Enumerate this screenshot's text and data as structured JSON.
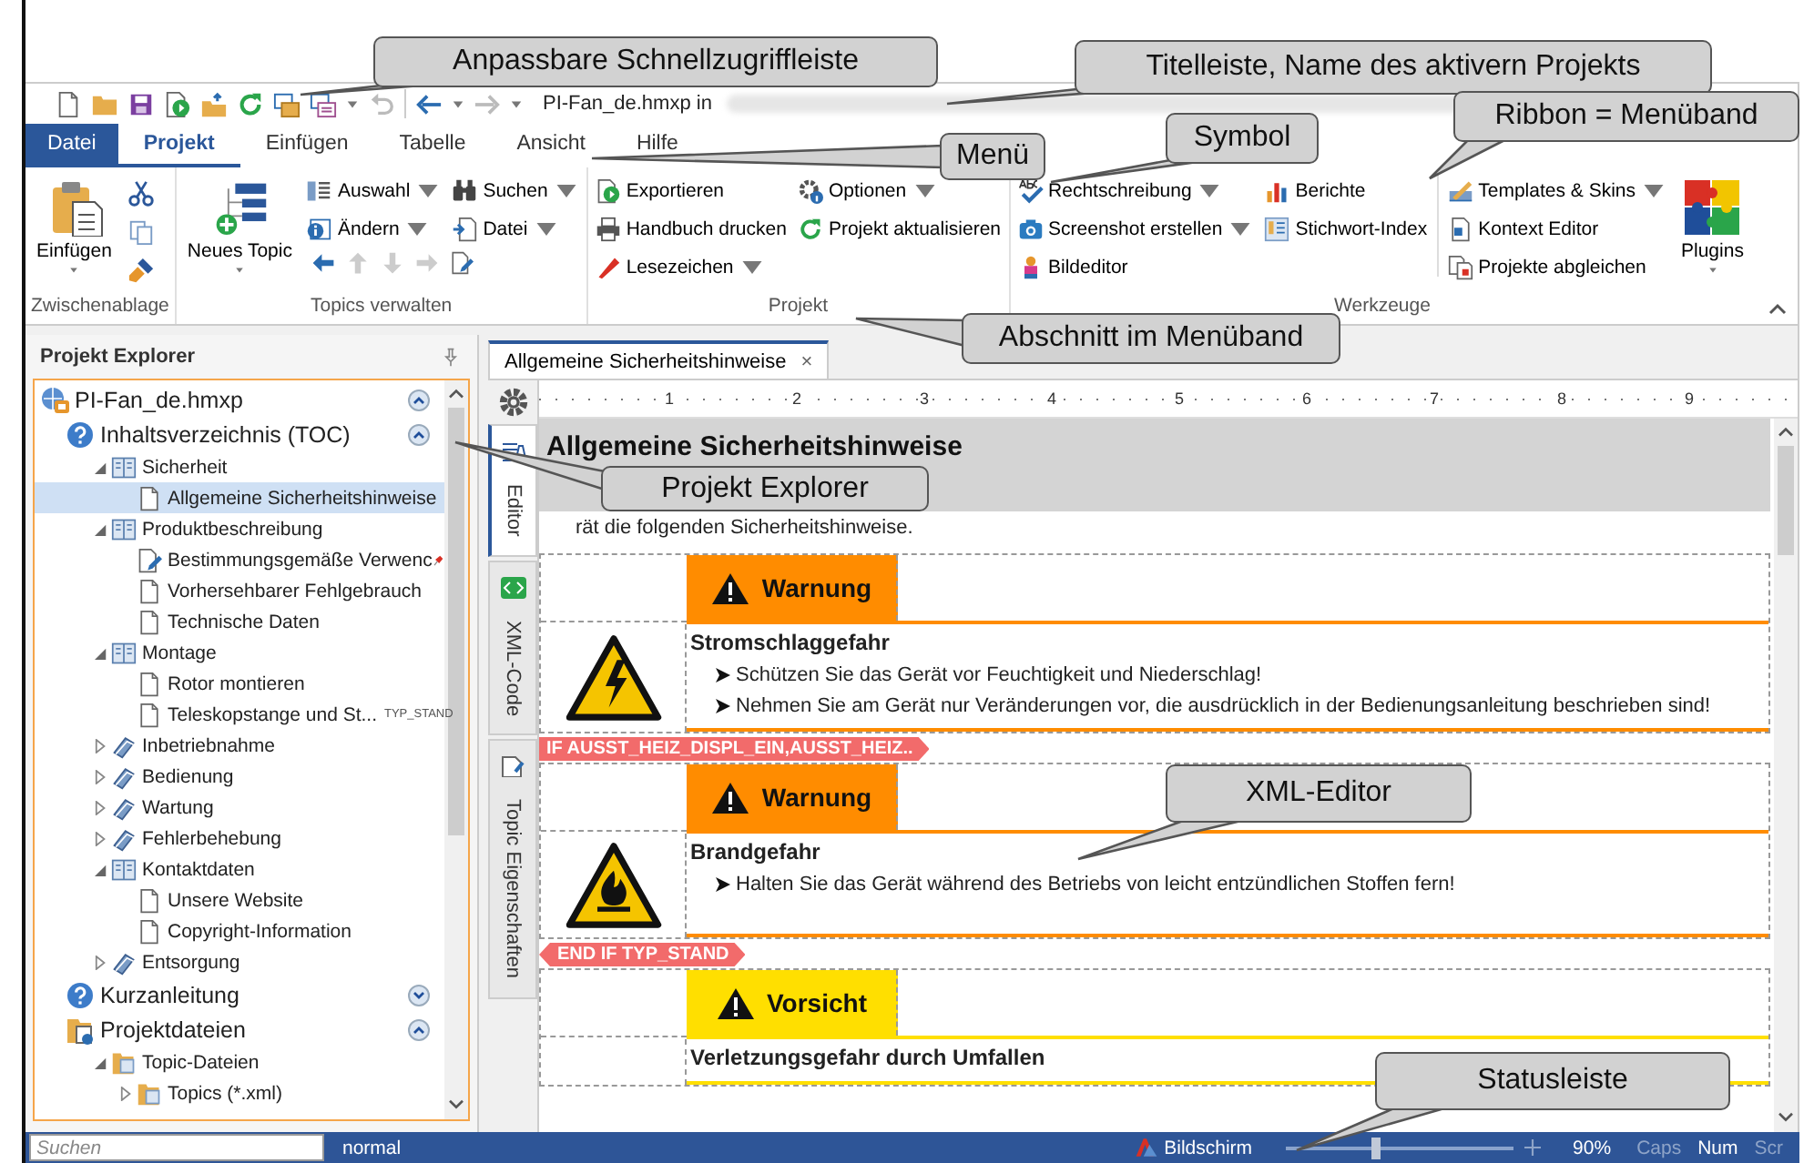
{
  "annotations": [
    {
      "text": "Anpassbare Schnellzugriffleiste"
    },
    {
      "text": "Titelleiste, Name des aktivern Projekts"
    },
    {
      "text": "Menü"
    },
    {
      "text": "Symbol"
    },
    {
      "text": "Ribbon = Menüband"
    },
    {
      "text": "Abschnitt im Menüband"
    },
    {
      "text": "Projekt Explorer"
    },
    {
      "text": "XML-Editor"
    },
    {
      "text": "Statusleiste"
    }
  ],
  "quick_access": {
    "title": "PI-Fan_de.hmxp in"
  },
  "menu_tabs": [
    {
      "label": "Datei",
      "kind": "file",
      "selected": false
    },
    {
      "label": "Projekt",
      "kind": "tab",
      "selected": true
    },
    {
      "label": "Einfügen",
      "kind": "tab",
      "selected": false
    },
    {
      "label": "Tabelle",
      "kind": "tab",
      "selected": false
    },
    {
      "label": "Ansicht",
      "kind": "tab",
      "selected": false
    },
    {
      "label": "Hilfe",
      "kind": "tab",
      "selected": false
    }
  ],
  "ribbon": {
    "groups": [
      {
        "label": "Zwischenablage",
        "columns": [
          {
            "kind": "large",
            "label": "Einfügen",
            "dropdown": true
          },
          {
            "kind": "icons"
          }
        ]
      },
      {
        "label": "Topics verwalten",
        "columns": [
          {
            "kind": "large",
            "label": "Neues Topic",
            "dropdown": true
          },
          {
            "kind": "grid",
            "items": [
              {
                "label": "Auswahl",
                "dropdown": true
              },
              {
                "label": "Suchen",
                "dropdown": true
              },
              {
                "label": "Ändern",
                "dropdown": true
              },
              {
                "label": "Datei",
                "dropdown": true
              }
            ]
          }
        ]
      },
      {
        "label": "Projekt",
        "columns": [
          {
            "kind": "stack",
            "items": [
              {
                "label": "Exportieren",
                "dropdown": false
              },
              {
                "label": "Handbuch drucken",
                "dropdown": false
              },
              {
                "label": "Lesezeichen",
                "dropdown": true
              }
            ]
          },
          {
            "kind": "stack",
            "items": [
              {
                "label": "Optionen",
                "dropdown": true
              },
              {
                "label": "Projekt aktualisieren",
                "dropdown": false
              }
            ]
          }
        ]
      },
      {
        "label": "Werkzeuge",
        "columns": [
          {
            "kind": "stack",
            "items": [
              {
                "label": "Rechtschreibung",
                "dropdown": true
              },
              {
                "label": "Screenshot erstellen",
                "dropdown": true
              },
              {
                "label": "Bildeditor",
                "dropdown": false
              }
            ]
          },
          {
            "kind": "stack",
            "items": [
              {
                "label": "Berichte",
                "dropdown": false
              },
              {
                "label": "Stichwort-Index",
                "dropdown": false
              }
            ]
          },
          {
            "kind": "separator"
          },
          {
            "kind": "stack",
            "items": [
              {
                "label": "Templates & Skins",
                "dropdown": true
              },
              {
                "label": "Kontext Editor",
                "dropdown": false
              },
              {
                "label": "Projekte abgleichen",
                "dropdown": false
              }
            ]
          },
          {
            "kind": "large",
            "label": "Plugins",
            "dropdown": true
          }
        ]
      }
    ]
  },
  "explorer": {
    "title": "Projekt Explorer",
    "tree": [
      {
        "label": "PI-Fan_de.hmxp",
        "kind": "project",
        "expanded": true,
        "selected": false,
        "children": [
          {
            "label": "Inhaltsverzeichnis (TOC)",
            "kind": "toc",
            "expanded": true,
            "selected": false,
            "children": [
              {
                "label": "Sicherheit",
                "kind": "chapter",
                "expanded": true,
                "selected": false,
                "children": [
                  {
                    "label": "Allgemeine Sicherheitshinweise",
                    "kind": "topic",
                    "selected": true
                  }
                ]
              },
              {
                "label": "Produktbeschreibung",
                "kind": "chapter",
                "expanded": true,
                "selected": false,
                "children": [
                  {
                    "label": "Bestimmungsgemäße Verwenc",
                    "kind": "topic-edit",
                    "selected": false,
                    "pinned": true
                  },
                  {
                    "label": "Vorhersehbarer Fehlgebrauch",
                    "kind": "topic",
                    "selected": false
                  },
                  {
                    "label": "Technische Daten",
                    "kind": "topic",
                    "selected": false
                  }
                ]
              },
              {
                "label": "Montage",
                "kind": "chapter",
                "expanded": true,
                "selected": false,
                "children": [
                  {
                    "label": "Rotor montieren",
                    "kind": "topic",
                    "selected": false
                  },
                  {
                    "label": "Teleskopstange und St...",
                    "kind": "topic",
                    "selected": false,
                    "tag": "TYP_STAND"
                  }
                ]
              },
              {
                "label": "Inbetriebnahme",
                "kind": "chapter",
                "expanded": false,
                "selected": false
              },
              {
                "label": "Bedienung",
                "kind": "chapter",
                "expanded": false,
                "selected": false
              },
              {
                "label": "Wartung",
                "kind": "chapter",
                "expanded": false,
                "selected": false
              },
              {
                "label": "Fehlerbehebung",
                "kind": "chapter",
                "expanded": false,
                "selected": false
              },
              {
                "label": "Kontaktdaten",
                "kind": "chapter",
                "expanded": true,
                "selected": false,
                "children": [
                  {
                    "label": "Unsere Website",
                    "kind": "topic",
                    "selected": false
                  },
                  {
                    "label": "Copyright-Information",
                    "kind": "topic",
                    "selected": false
                  }
                ]
              },
              {
                "label": "Entsorgung",
                "kind": "chapter",
                "expanded": false,
                "selected": false
              }
            ]
          },
          {
            "label": "Kurzanleitung",
            "kind": "toc",
            "expanded": false,
            "selected": false
          },
          {
            "label": "Projektdateien",
            "kind": "files",
            "expanded": true,
            "selected": false,
            "children": [
              {
                "label": "Topic-Dateien",
                "kind": "folder",
                "expanded": true,
                "selected": false,
                "children": [
                  {
                    "label": "Topics (*.xml)",
                    "kind": "folder",
                    "expanded": false,
                    "selected": false
                  }
                ]
              }
            ]
          }
        ]
      }
    ]
  },
  "side_tabs": [
    {
      "label": "Editor",
      "selected": true
    },
    {
      "label": "XML-Code",
      "selected": false
    },
    {
      "label": "Topic Eigenschaften",
      "selected": false
    }
  ],
  "document_tab": {
    "label": "Allgemeine Sicherheitshinweise",
    "close": "×",
    "selected": true
  },
  "ruler": {
    "marks": [
      "1",
      "2",
      "3",
      "4",
      "5",
      "6",
      "7",
      "8",
      "9"
    ]
  },
  "document": [
    {
      "kind": "heading",
      "text": "Allgemeine Sicherheitshinweise"
    },
    {
      "kind": "paragraph",
      "text": "rät die folgenden Sicherheitshinweise."
    },
    {
      "kind": "safety",
      "color": "#ff8c00",
      "signal": "Warnung",
      "hazard": "Stromschlaggefahr",
      "bullets": [
        "Schützen Sie das Gerät vor Feuchtigkeit und Niederschlag!",
        "Nehmen Sie am Gerät nur Veränderungen vor, die ausdrücklich in der Bedienungsanleitung beschrieben sind!"
      ]
    },
    {
      "kind": "condition",
      "text": "IF AUSST_HEIZ_DISPL_EIN,AUSST_HEIZ.."
    },
    {
      "kind": "safety",
      "color": "#ff8c00",
      "signal": "Warnung",
      "hazard": "Brandgefahr",
      "bullets": [
        "Halten Sie das Gerät während des Betriebs von leicht entzündlichen Stoffen fern!"
      ]
    },
    {
      "kind": "condition",
      "text": "END IF TYP_STAND"
    },
    {
      "kind": "safety",
      "color": "#ffdf00",
      "signal": "Vorsicht",
      "hazard": "Verletzungsgefahr durch Umfallen"
    }
  ],
  "status_bar": {
    "search": {
      "placeholder": "Suchen"
    },
    "style": "normal",
    "view_mode": "Bildschirm",
    "zoom": {
      "level": 0.38,
      "reading": "90%"
    },
    "keys": [
      {
        "label": "Caps",
        "on": false
      },
      {
        "label": "Num",
        "on": true
      },
      {
        "label": "Scr",
        "on": false
      }
    ]
  }
}
